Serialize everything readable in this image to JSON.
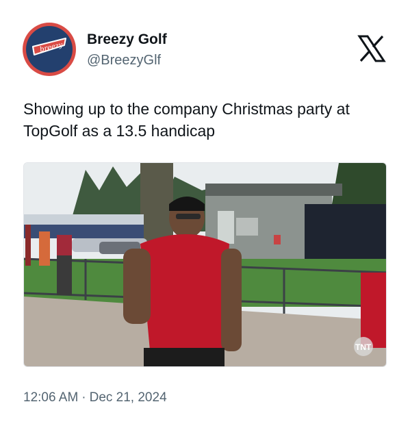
{
  "author": {
    "display_name": "Breezy Golf",
    "handle": "@BreezyGlf",
    "avatar_icon": "breezy-pennant-logo",
    "avatar_logo_text": "breezy",
    "avatar_colors": {
      "ring": "#d94b45",
      "background": "#23406e",
      "pennant": "#d94b45"
    }
  },
  "platform_icon": "x-logo-icon",
  "tweet": {
    "text": "Showing up to the company Christmas party at TopGolf as a 13.5 handicap"
  },
  "media": {
    "type": "video-still",
    "watermark": "TNT"
  },
  "meta": {
    "time": "12:06 AM",
    "separator": "·",
    "date": "Dec 21, 2024"
  },
  "colors": {
    "text_primary": "#0f1419",
    "text_secondary": "#536471"
  }
}
